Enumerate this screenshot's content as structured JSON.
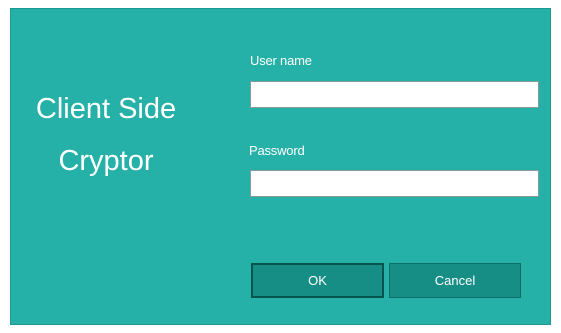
{
  "app": {
    "title_line1": "Client Side",
    "title_line2": "Cryptor"
  },
  "form": {
    "username_label": "User name",
    "username_value": "",
    "password_label": "Password",
    "password_value": ""
  },
  "buttons": {
    "ok_label": "OK",
    "cancel_label": "Cancel"
  },
  "colors": {
    "background": "#25b0a8",
    "button": "#168e86",
    "text": "#ffffff"
  }
}
